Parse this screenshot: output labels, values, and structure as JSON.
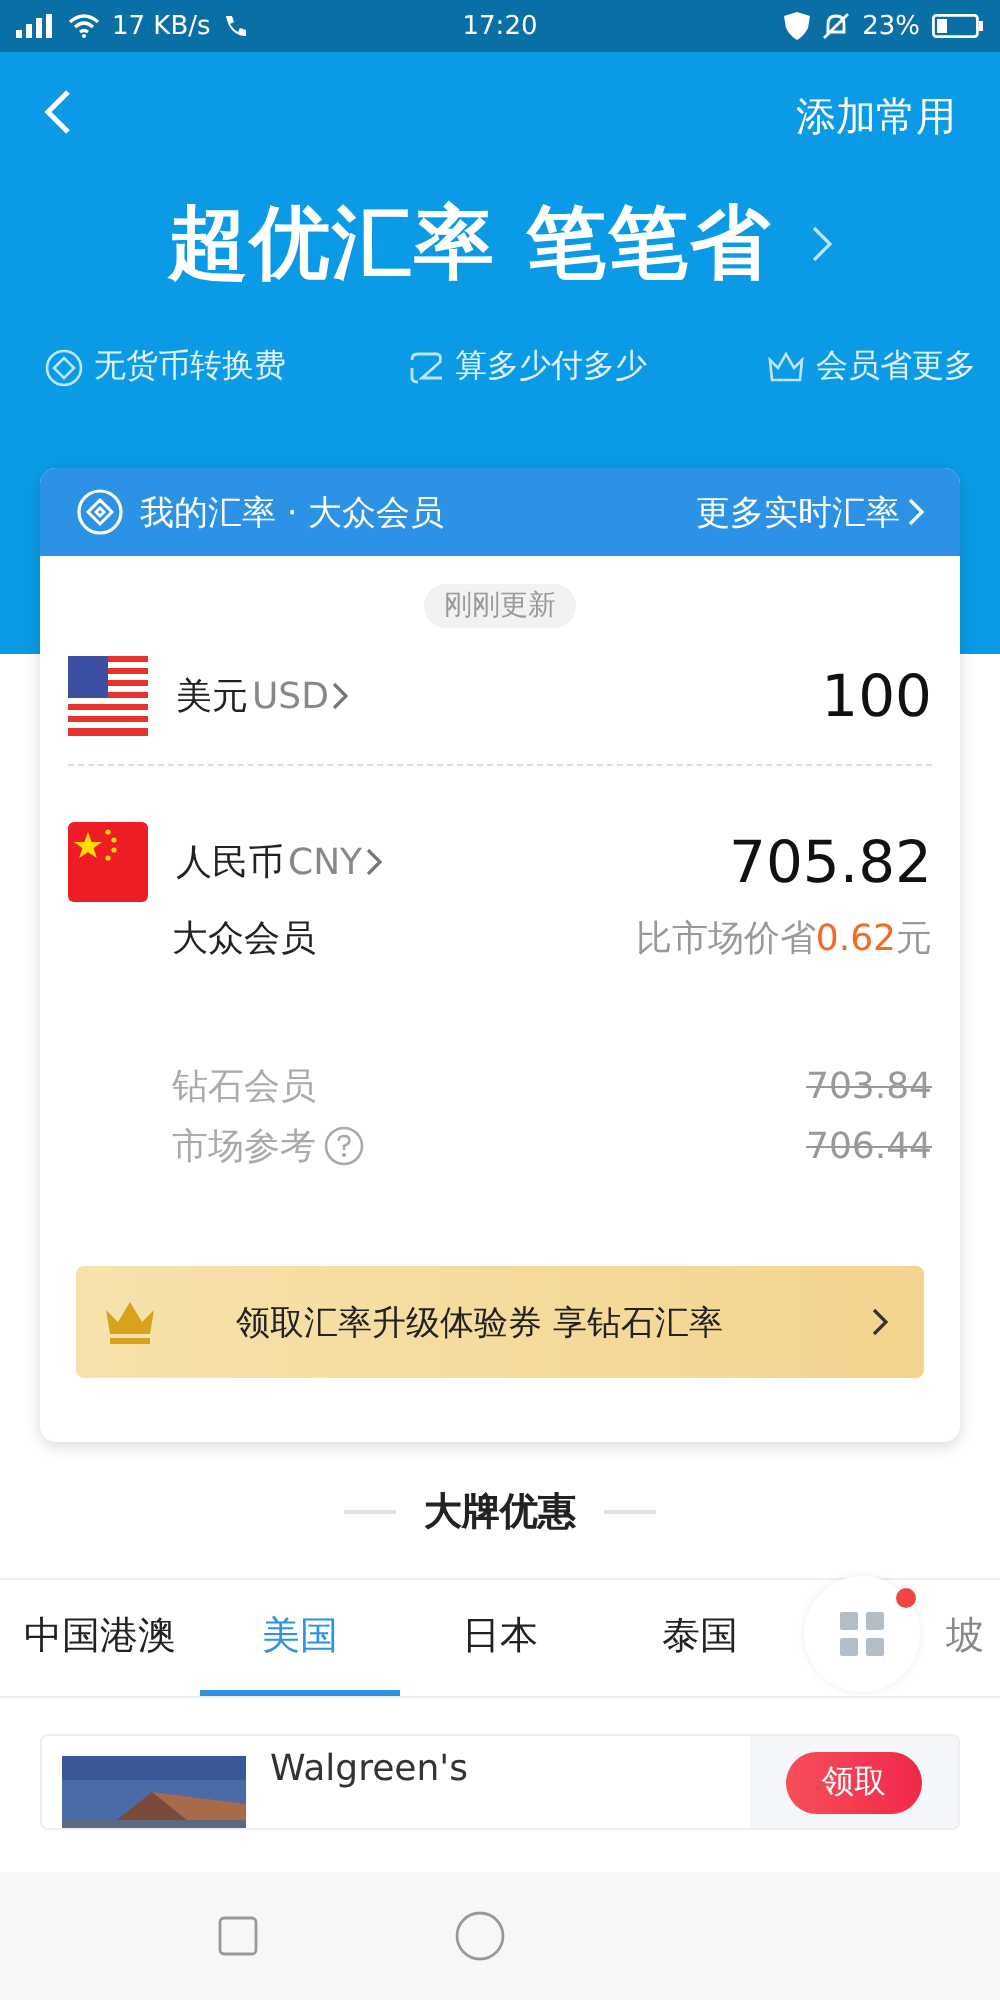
{
  "status_bar": {
    "network_speed": "17 KB/s",
    "time": "17:20",
    "battery": "23%"
  },
  "header": {
    "action": "添加常用",
    "slogan": "超优汇率 笔笔省",
    "features": [
      {
        "kind": "coin",
        "label": "无货币转换费"
      },
      {
        "kind": "loop",
        "label": "算多少付多少"
      },
      {
        "kind": "crown",
        "label": "会员省更多"
      }
    ]
  },
  "rate_card": {
    "title": "我的汇率 · 大众会员",
    "more_link": "更多实时汇率",
    "updated": "刚刚更新",
    "currencies": [
      {
        "kind": "us",
        "name": "美元",
        "code": "USD",
        "amount": "100"
      },
      {
        "kind": "cn",
        "name": "人民币",
        "code": "CNY",
        "amount": "705.82"
      }
    ],
    "member_tier": "大众会员",
    "savings_text": "比市场价省",
    "savings_value": "0.62",
    "savings_unit": "元",
    "comparisons": [
      {
        "label": "钻石会员",
        "value": "703.84",
        "help": false
      },
      {
        "label": "市场参考",
        "value": "706.44",
        "help": true
      }
    ],
    "promo": "领取汇率升级体验券 享钻石汇率"
  },
  "brand_deals": {
    "title": "大牌优惠",
    "menu_badge": true,
    "tabs": [
      {
        "label": "中国港澳",
        "selected": false
      },
      {
        "label": "美国",
        "selected": true
      },
      {
        "label": "日本",
        "selected": false
      },
      {
        "label": "泰国",
        "selected": false
      },
      {
        "label": "坡",
        "selected": false
      }
    ],
    "deals": [
      {
        "name": "Walgreen's",
        "action": "领取"
      }
    ]
  }
}
